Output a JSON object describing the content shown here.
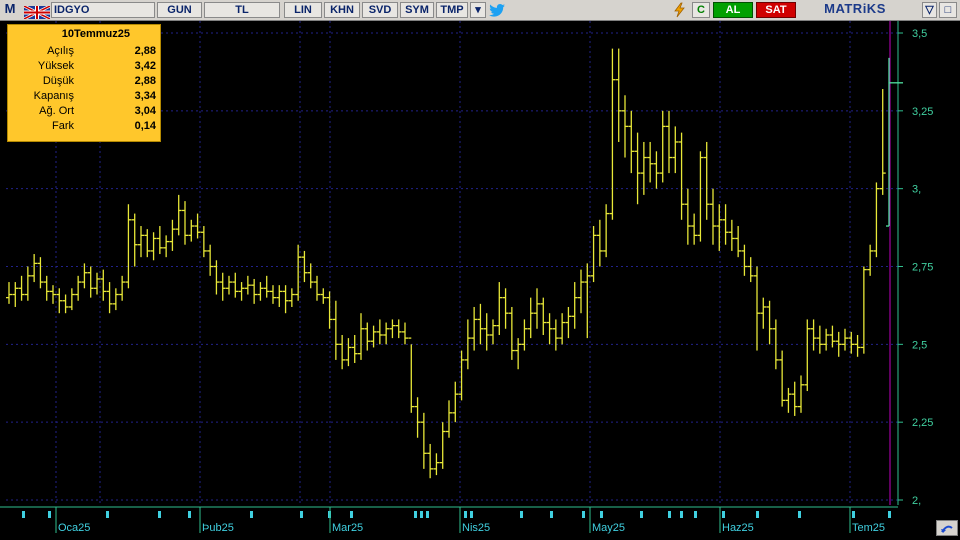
{
  "toolbar": {
    "m_label": "M",
    "symbol": "IDGYO",
    "period": "GUN",
    "currency": "TL",
    "scale": "LIN",
    "khn": "KHN",
    "svd": "SVD",
    "sym": "SYM",
    "tmp": "TMP",
    "c_label": "C",
    "buy": "AL",
    "sell": "SAT",
    "brand": "MATRiKS",
    "buy_color": "#00a000",
    "sell_color": "#d00000"
  },
  "info_box": {
    "date": "10Temmuz25",
    "rows": [
      {
        "label": "Açılış",
        "value": "2,88"
      },
      {
        "label": "Yüksek",
        "value": "3,42"
      },
      {
        "label": "Düşük",
        "value": "2,88"
      },
      {
        "label": "Kapanış",
        "value": "3,34"
      },
      {
        "label": "Ağ. Ort",
        "value": "3,04"
      },
      {
        "label": "Fark",
        "value": "0,14"
      }
    ]
  },
  "chart_data": {
    "type": "ohlc",
    "symbol": "IDGYO",
    "bar_color": "#e8e838",
    "grid": true,
    "ylim": [
      2.0,
      3.5
    ],
    "y_ticks": [
      "2,",
      "2,25",
      "2,5",
      "2,75",
      "3,",
      "3,25",
      "3,5"
    ],
    "x_month_labels": [
      "Oca25",
      "Þub25",
      "Mar25",
      "Nis25",
      "May25",
      "Haz25",
      "Tem25"
    ],
    "ohlc": [
      [
        2.65,
        2.7,
        2.63,
        2.66
      ],
      [
        2.66,
        2.7,
        2.62,
        2.68
      ],
      [
        2.68,
        2.72,
        2.64,
        2.66
      ],
      [
        2.66,
        2.75,
        2.64,
        2.72
      ],
      [
        2.72,
        2.79,
        2.7,
        2.76
      ],
      [
        2.76,
        2.78,
        2.68,
        2.7
      ],
      [
        2.7,
        2.72,
        2.64,
        2.67
      ],
      [
        2.67,
        2.69,
        2.63,
        2.66
      ],
      [
        2.66,
        2.68,
        2.6,
        2.64
      ],
      [
        2.64,
        2.66,
        2.6,
        2.62
      ],
      [
        2.62,
        2.68,
        2.61,
        2.66
      ],
      [
        2.66,
        2.72,
        2.64,
        2.7
      ],
      [
        2.7,
        2.76,
        2.68,
        2.73
      ],
      [
        2.73,
        2.75,
        2.65,
        2.68
      ],
      [
        2.68,
        2.73,
        2.66,
        2.71
      ],
      [
        2.71,
        2.74,
        2.64,
        2.67
      ],
      [
        2.67,
        2.7,
        2.6,
        2.63
      ],
      [
        2.63,
        2.68,
        2.61,
        2.66
      ],
      [
        2.66,
        2.72,
        2.64,
        2.7
      ],
      [
        2.7,
        2.95,
        2.68,
        2.9
      ],
      [
        2.9,
        2.92,
        2.75,
        2.82
      ],
      [
        2.82,
        2.88,
        2.78,
        2.85
      ],
      [
        2.85,
        2.87,
        2.78,
        2.8
      ],
      [
        2.8,
        2.86,
        2.77,
        2.84
      ],
      [
        2.84,
        2.88,
        2.79,
        2.81
      ],
      [
        2.81,
        2.85,
        2.78,
        2.83
      ],
      [
        2.83,
        2.9,
        2.8,
        2.87
      ],
      [
        2.87,
        2.98,
        2.85,
        2.93
      ],
      [
        2.93,
        2.96,
        2.82,
        2.85
      ],
      [
        2.85,
        2.9,
        2.83,
        2.88
      ],
      [
        2.88,
        2.92,
        2.84,
        2.86
      ],
      [
        2.86,
        2.88,
        2.78,
        2.8
      ],
      [
        2.8,
        2.82,
        2.72,
        2.75
      ],
      [
        2.75,
        2.77,
        2.66,
        2.7
      ],
      [
        2.7,
        2.73,
        2.64,
        2.68
      ],
      [
        2.68,
        2.72,
        2.66,
        2.7
      ],
      [
        2.7,
        2.73,
        2.65,
        2.67
      ],
      [
        2.67,
        2.7,
        2.64,
        2.68
      ],
      [
        2.68,
        2.72,
        2.66,
        2.69
      ],
      [
        2.69,
        2.71,
        2.63,
        2.66
      ],
      [
        2.66,
        2.7,
        2.64,
        2.68
      ],
      [
        2.68,
        2.72,
        2.65,
        2.67
      ],
      [
        2.67,
        2.69,
        2.63,
        2.65
      ],
      [
        2.65,
        2.69,
        2.62,
        2.67
      ],
      [
        2.67,
        2.69,
        2.6,
        2.64
      ],
      [
        2.64,
        2.68,
        2.62,
        2.66
      ],
      [
        2.66,
        2.82,
        2.64,
        2.78
      ],
      [
        2.78,
        2.8,
        2.7,
        2.73
      ],
      [
        2.73,
        2.76,
        2.68,
        2.7
      ],
      [
        2.7,
        2.72,
        2.64,
        2.66
      ],
      [
        2.66,
        2.68,
        2.63,
        2.65
      ],
      [
        2.65,
        2.67,
        2.55,
        2.58
      ],
      [
        2.58,
        2.64,
        2.45,
        2.5
      ],
      [
        2.5,
        2.53,
        2.42,
        2.45
      ],
      [
        2.45,
        2.52,
        2.43,
        2.49
      ],
      [
        2.49,
        2.53,
        2.44,
        2.47
      ],
      [
        2.47,
        2.6,
        2.45,
        2.55
      ],
      [
        2.55,
        2.57,
        2.48,
        2.51
      ],
      [
        2.51,
        2.56,
        2.49,
        2.54
      ],
      [
        2.54,
        2.58,
        2.5,
        2.53
      ],
      [
        2.53,
        2.57,
        2.5,
        2.55
      ],
      [
        2.55,
        2.58,
        2.52,
        2.56
      ],
      [
        2.56,
        2.58,
        2.52,
        2.54
      ],
      [
        2.54,
        2.57,
        2.5,
        2.52
      ],
      [
        2.52,
        2.5,
        2.28,
        2.3
      ],
      [
        2.3,
        2.33,
        2.2,
        2.25
      ],
      [
        2.25,
        2.28,
        2.1,
        2.15
      ],
      [
        2.15,
        2.18,
        2.07,
        2.1
      ],
      [
        2.1,
        2.15,
        2.08,
        2.12
      ],
      [
        2.12,
        2.25,
        2.1,
        2.22
      ],
      [
        2.22,
        2.32,
        2.2,
        2.28
      ],
      [
        2.28,
        2.38,
        2.25,
        2.34
      ],
      [
        2.34,
        2.48,
        2.32,
        2.45
      ],
      [
        2.45,
        2.58,
        2.42,
        2.52
      ],
      [
        2.52,
        2.62,
        2.48,
        2.58
      ],
      [
        2.58,
        2.63,
        2.5,
        2.55
      ],
      [
        2.55,
        2.6,
        2.48,
        2.53
      ],
      [
        2.53,
        2.58,
        2.5,
        2.56
      ],
      [
        2.56,
        2.7,
        2.53,
        2.65
      ],
      [
        2.65,
        2.68,
        2.55,
        2.6
      ],
      [
        2.6,
        2.62,
        2.45,
        2.48
      ],
      [
        2.48,
        2.52,
        2.42,
        2.5
      ],
      [
        2.5,
        2.58,
        2.48,
        2.55
      ],
      [
        2.55,
        2.65,
        2.52,
        2.6
      ],
      [
        2.6,
        2.68,
        2.55,
        2.63
      ],
      [
        2.63,
        2.65,
        2.53,
        2.57
      ],
      [
        2.57,
        2.6,
        2.5,
        2.55
      ],
      [
        2.55,
        2.58,
        2.48,
        2.52
      ],
      [
        2.52,
        2.6,
        2.5,
        2.57
      ],
      [
        2.57,
        2.62,
        2.52,
        2.59
      ],
      [
        2.59,
        2.7,
        2.55,
        2.65
      ],
      [
        2.65,
        2.74,
        2.6,
        2.7
      ],
      [
        2.7,
        2.76,
        2.52,
        2.72
      ],
      [
        2.72,
        2.88,
        2.7,
        2.85
      ],
      [
        2.85,
        2.9,
        2.75,
        2.8
      ],
      [
        2.8,
        2.95,
        2.78,
        2.92
      ],
      [
        2.92,
        3.45,
        2.9,
        3.35
      ],
      [
        3.35,
        3.45,
        3.15,
        3.25
      ],
      [
        3.25,
        3.3,
        3.1,
        3.2
      ],
      [
        3.2,
        3.25,
        3.05,
        3.12
      ],
      [
        3.12,
        3.18,
        2.95,
        3.05
      ],
      [
        3.05,
        3.15,
        2.98,
        3.1
      ],
      [
        3.1,
        3.15,
        3.02,
        3.08
      ],
      [
        3.08,
        3.12,
        3.0,
        3.05
      ],
      [
        3.05,
        3.25,
        3.02,
        3.2
      ],
      [
        3.2,
        3.25,
        3.05,
        3.1
      ],
      [
        3.1,
        3.2,
        3.05,
        3.15
      ],
      [
        3.15,
        3.18,
        2.9,
        2.95
      ],
      [
        2.95,
        3.0,
        2.82,
        2.88
      ],
      [
        2.88,
        2.92,
        2.82,
        2.85
      ],
      [
        2.85,
        3.12,
        2.83,
        3.1
      ],
      [
        3.1,
        3.15,
        2.9,
        2.95
      ],
      [
        2.95,
        3.0,
        2.82,
        2.88
      ],
      [
        2.88,
        2.95,
        2.8,
        2.9
      ],
      [
        2.9,
        2.95,
        2.82,
        2.86
      ],
      [
        2.86,
        2.9,
        2.8,
        2.84
      ],
      [
        2.84,
        2.88,
        2.78,
        2.8
      ],
      [
        2.8,
        2.82,
        2.72,
        2.75
      ],
      [
        2.75,
        2.78,
        2.7,
        2.72
      ],
      [
        2.72,
        2.75,
        2.48,
        2.6
      ],
      [
        2.6,
        2.65,
        2.55,
        2.62
      ],
      [
        2.62,
        2.64,
        2.5,
        2.55
      ],
      [
        2.55,
        2.58,
        2.42,
        2.45
      ],
      [
        2.45,
        2.48,
        2.3,
        2.32
      ],
      [
        2.32,
        2.36,
        2.28,
        2.34
      ],
      [
        2.34,
        2.38,
        2.27,
        2.3
      ],
      [
        2.3,
        2.4,
        2.28,
        2.37
      ],
      [
        2.37,
        2.58,
        2.35,
        2.55
      ],
      [
        2.55,
        2.58,
        2.48,
        2.52
      ],
      [
        2.52,
        2.56,
        2.47,
        2.5
      ],
      [
        2.5,
        2.55,
        2.48,
        2.53
      ],
      [
        2.53,
        2.56,
        2.49,
        2.51
      ],
      [
        2.51,
        2.54,
        2.46,
        2.5
      ],
      [
        2.5,
        2.55,
        2.48,
        2.52
      ],
      [
        2.52,
        2.54,
        2.47,
        2.5
      ],
      [
        2.5,
        2.53,
        2.46,
        2.49
      ],
      [
        2.49,
        2.75,
        2.47,
        2.74
      ],
      [
        2.74,
        2.82,
        2.72,
        2.8
      ],
      [
        2.8,
        3.02,
        2.78,
        3.0
      ],
      [
        3.0,
        3.32,
        2.98,
        3.05
      ],
      [
        2.88,
        3.42,
        2.88,
        3.34
      ]
    ]
  }
}
